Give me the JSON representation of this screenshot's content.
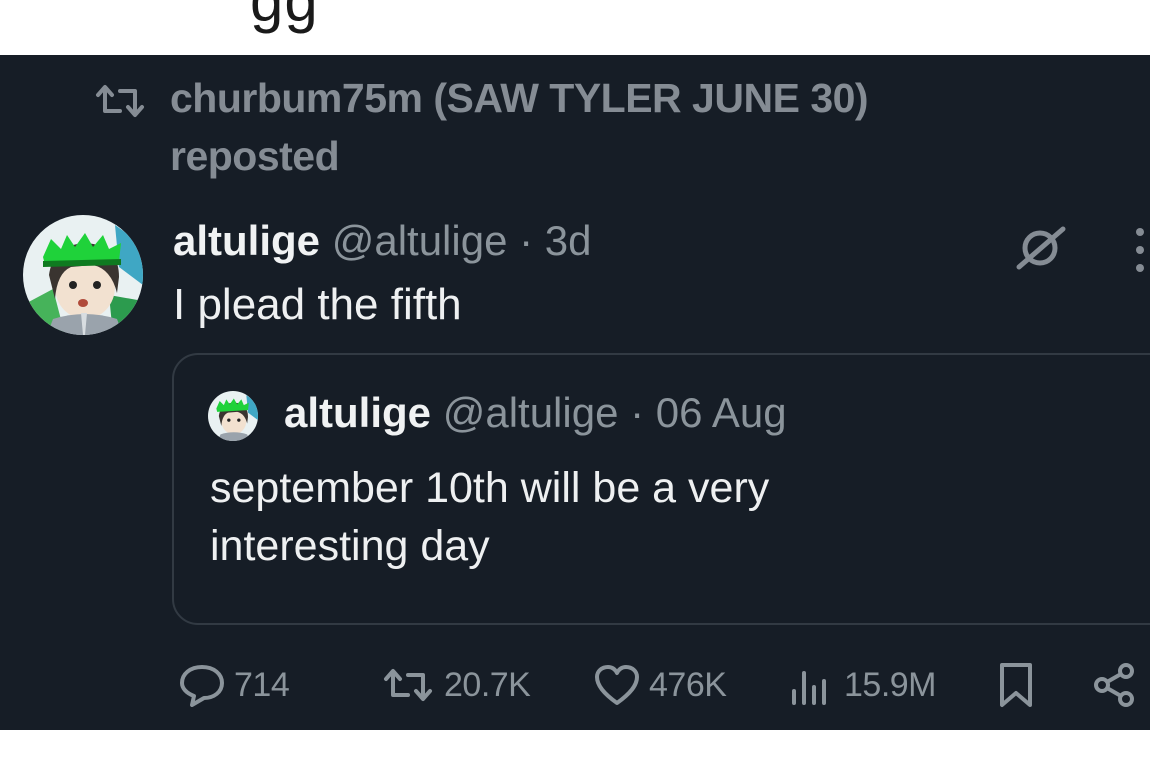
{
  "top_fragment": "gg",
  "repost": {
    "icon": "repost-icon",
    "text": "churbum75m (SAW TYLER JUNE 30) reposted"
  },
  "tweet": {
    "author_name": "altulige",
    "author_handle": "@altulige",
    "separator": " · ",
    "time": "3d",
    "text": "I plead the fifth",
    "grok_icon": "grok-icon",
    "more_icon": "more-dots-icon"
  },
  "quote": {
    "author_name": "altulige",
    "author_handle": "@altulige",
    "separator": " · ",
    "time": "06 Aug",
    "text": "september 10th will be a very interesting day"
  },
  "actions": {
    "replies": "714",
    "reposts": "20.7K",
    "likes": "476K",
    "views": "15.9M",
    "bookmark_icon": "bookmark-icon",
    "share_icon": "share-icon"
  },
  "colors": {
    "background": "#161d26",
    "text": "#e7e9ea",
    "muted": "#8b949b",
    "border": "#323a43"
  }
}
